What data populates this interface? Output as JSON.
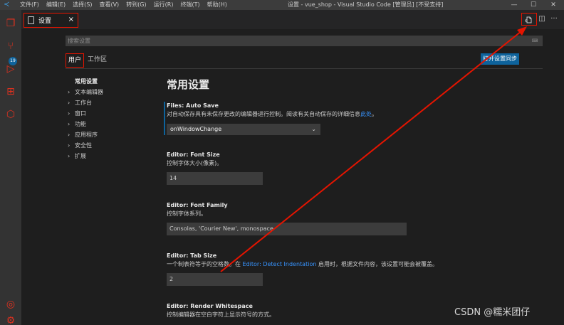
{
  "titlebar": {
    "menus": [
      "文件(F)",
      "编辑(E)",
      "选择(S)",
      "查看(V)",
      "转到(G)",
      "运行(R)",
      "终端(T)",
      "帮助(H)"
    ],
    "window_title": "设置 - vue_shop - Visual Studio Code [管理员] [不受支持]",
    "minimize": "—",
    "maximize": "☐",
    "close": "✕"
  },
  "activity": {
    "scm_badge": "19"
  },
  "tabbar": {
    "tab_label": "设置",
    "tab_close": "×",
    "split": "◫",
    "more": "···"
  },
  "settings": {
    "search_placeholder": "搜索设置",
    "search_right": "⌨",
    "scopes": [
      "用户",
      "工作区"
    ],
    "sync_button": "打开设置同步",
    "toc": {
      "selected": "常用设置",
      "items": [
        "文本编辑器",
        "工作台",
        "窗口",
        "功能",
        "应用程序",
        "安全性",
        "扩展"
      ]
    },
    "group_title": "常用设置",
    "auto_save": {
      "category": "Files:",
      "name": "Auto Save",
      "desc": "对自动保存具有未保存更改的编辑器进行控制。阅读有关自动保存的详细信息",
      "link": "此处",
      "desc_end": "。",
      "value": "onWindowChange"
    },
    "font_size": {
      "category": "Editor:",
      "name": "Font Size",
      "desc": "控制字体大小(像素)。",
      "value": "14"
    },
    "font_family": {
      "category": "Editor:",
      "name": "Font Family",
      "desc": "控制字体系列。",
      "value": "Consolas, 'Courier New', monospace"
    },
    "tab_size": {
      "category": "Editor:",
      "name": "Tab Size",
      "desc_pre": "一个制表符等于的空格数。在",
      "link": "Editor: Detect Indentation",
      "desc_post": "启用时，根据文件内容，该设置可能会被覆盖。",
      "value": "2"
    },
    "render_whitespace": {
      "category": "Editor:",
      "name": "Render Whitespace",
      "desc": "控制编辑器在空白字符上显示符号的方式。"
    }
  },
  "watermark": "CSDN @糯米团仔",
  "colors": {
    "annotation": "#e51400",
    "accent": "#0e639c",
    "link": "#3794ff"
  }
}
